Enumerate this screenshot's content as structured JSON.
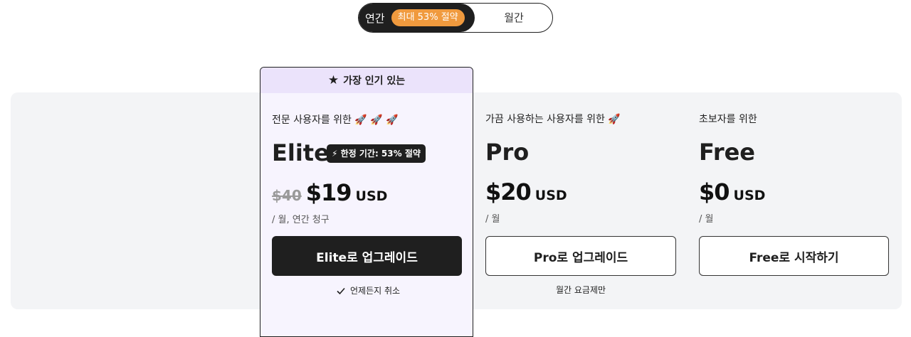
{
  "billing_toggle": {
    "yearly_label": "연간",
    "yearly_badge": "최대 53% 절약",
    "monthly_label": "월간",
    "selected": "yearly"
  },
  "plans": [
    {
      "badge": "가장 인기 있는",
      "subtitle": "전문 사용자를 위한 🚀 🚀 🚀",
      "name": "Elite",
      "limited_offer": "⚡ 한정 기간: 53% 절약",
      "old_price": "$40",
      "price": "$19",
      "currency": "USD",
      "billing_note": "/ 월, 연간 청구",
      "button_label": "Elite로 업그레이드",
      "footnote": "언제든지 취소"
    },
    {
      "subtitle": "가끔 사용하는 사용자를 위한 🚀",
      "name": "Pro",
      "price": "$20",
      "currency": "USD",
      "billing_note": "/ 월",
      "button_label": "Pro로 업그레이드",
      "footnote": "월간 요금제만"
    },
    {
      "subtitle": "초보자를 위한",
      "name": "Free",
      "price": "$0",
      "currency": "USD",
      "billing_note": "/ 월",
      "button_label": "Free로 시작하기"
    }
  ],
  "icons": {
    "popular": "star-icon",
    "footnote_elite": "check-icon"
  },
  "colors": {
    "dark": "#1f1f1f",
    "badge_orange": "#f09a3e",
    "elite_bg": "#f7f4fe",
    "popular_bg": "#ebe3fb",
    "band_bg": "#f3f4f6"
  }
}
